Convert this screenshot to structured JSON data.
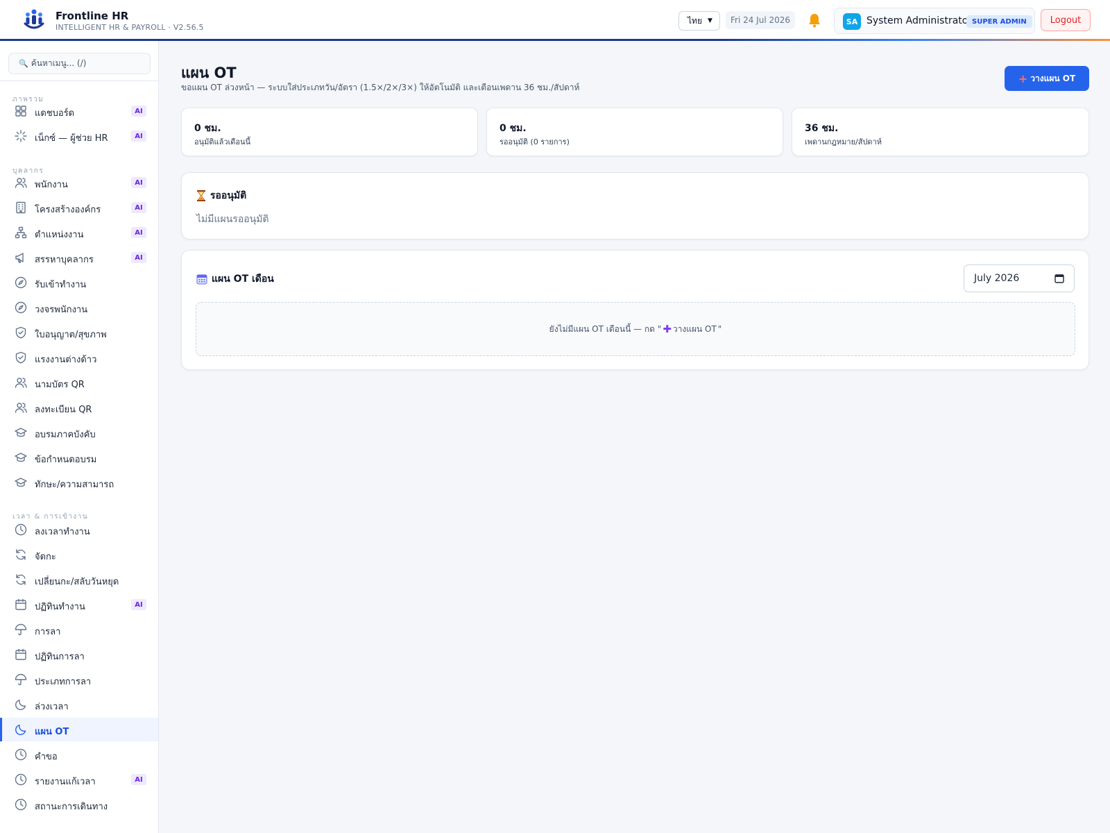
{
  "header": {
    "brand_name": "Frontline HR",
    "brand_sub": "INTELLIGENT HR & PAYROLL · V2.56.5",
    "language": "ไทย",
    "date": "Fri 24 Jul 2026",
    "user_initials": "SA",
    "user_name": "System Administrator",
    "role_badge": "SUPER ADMIN",
    "logout_label": "Logout"
  },
  "sidebar": {
    "search_placeholder": "ค้นหาเมนู... (/)",
    "sections": {
      "overview": "ภาพรวม",
      "people": "บุคลากร",
      "time": "เวลา & การเข้างาน"
    },
    "items": [
      {
        "label": "แดชบอร์ด",
        "icon": "dashboard-icon",
        "ai": "AI"
      },
      {
        "label": "เน็กซ์ — ผู้ช่วย HR",
        "icon": "sparkle-icon",
        "ai": "AI"
      },
      {
        "label": "พนักงาน",
        "icon": "users-icon",
        "ai": "AI"
      },
      {
        "label": "โครงสร้างองค์กร",
        "icon": "building-icon",
        "ai": "AI"
      },
      {
        "label": "ตำแหน่งงาน",
        "icon": "org-chart-icon",
        "ai": "AI"
      },
      {
        "label": "สรรหาบุคลากร",
        "icon": "megaphone-icon",
        "ai": "AI"
      },
      {
        "label": "รับเข้าทำงาน",
        "icon": "compass-icon"
      },
      {
        "label": "วงจรพนักงาน",
        "icon": "compass-icon"
      },
      {
        "label": "ใบอนุญาต/สุขภาพ",
        "icon": "shield-icon"
      },
      {
        "label": "แรงงานต่างด้าว",
        "icon": "shield-icon"
      },
      {
        "label": "นามบัตร QR",
        "icon": "users-icon"
      },
      {
        "label": "ลงทะเบียน QR",
        "icon": "users-icon"
      },
      {
        "label": "อบรมภาคบังคับ",
        "icon": "graduation-cap-icon"
      },
      {
        "label": "ข้อกำหนดอบรม",
        "icon": "graduation-cap-icon"
      },
      {
        "label": "ทักษะ/ความสามารถ",
        "icon": "graduation-cap-icon"
      },
      {
        "label": "ลงเวลาทำงาน",
        "icon": "clock-icon"
      },
      {
        "label": "จัดกะ",
        "icon": "refresh-icon"
      },
      {
        "label": "เปลี่ยนกะ/สลับวันหยุด",
        "icon": "refresh-icon"
      },
      {
        "label": "ปฏิทินทำงาน",
        "icon": "calendar-icon",
        "ai": "AI"
      },
      {
        "label": "การลา",
        "icon": "umbrella-icon"
      },
      {
        "label": "ปฏิทินการลา",
        "icon": "calendar-icon"
      },
      {
        "label": "ประเภทการลา",
        "icon": "umbrella-icon"
      },
      {
        "label": "ล่วงเวลา",
        "icon": "moon-icon"
      },
      {
        "label": "แผน OT",
        "icon": "moon-icon"
      },
      {
        "label": "คำขอ",
        "icon": "clock-icon"
      },
      {
        "label": "รายงานแก้เวลา",
        "icon": "clock-icon",
        "ai": "AI"
      },
      {
        "label": "สถานะการเดินทาง",
        "icon": "clock-icon"
      }
    ]
  },
  "main": {
    "title": "แผน OT",
    "subtitle": "ขอแผน OT ล่วงหน้า — ระบบใส่ประเภทวัน/อัตรา (1.5×/2×/3×) ให้อัตโนมัติ และเตือนเพดาน 36 ชม./สัปดาห์",
    "plan_button": "วางแผน OT",
    "stats": [
      {
        "value": "0 ชม.",
        "label": "อนุมัติแล้วเดือนนี้"
      },
      {
        "value": "0 ชม.",
        "label": "รออนุมัติ (0 รายการ)"
      },
      {
        "value": "36 ชม.",
        "label": "เพดานกฎหมาย/สัปดาห์"
      }
    ],
    "pending_title": "รออนุมัติ",
    "pending_empty": "ไม่มีแผนรออนุมัติ",
    "month_title": "แผน OT เดือน",
    "month_value": "July 2026",
    "month_empty_prefix": "ยังไม่มีแผน OT เดือนนี้ — กด \"",
    "month_empty_button": "วางแผน OT",
    "month_empty_suffix": "\""
  },
  "colors": {
    "primary": "#2563eb",
    "logout": "#dc2626",
    "ai_badge": "#6d28d9",
    "active_nav_bg": "#eff4ff"
  }
}
